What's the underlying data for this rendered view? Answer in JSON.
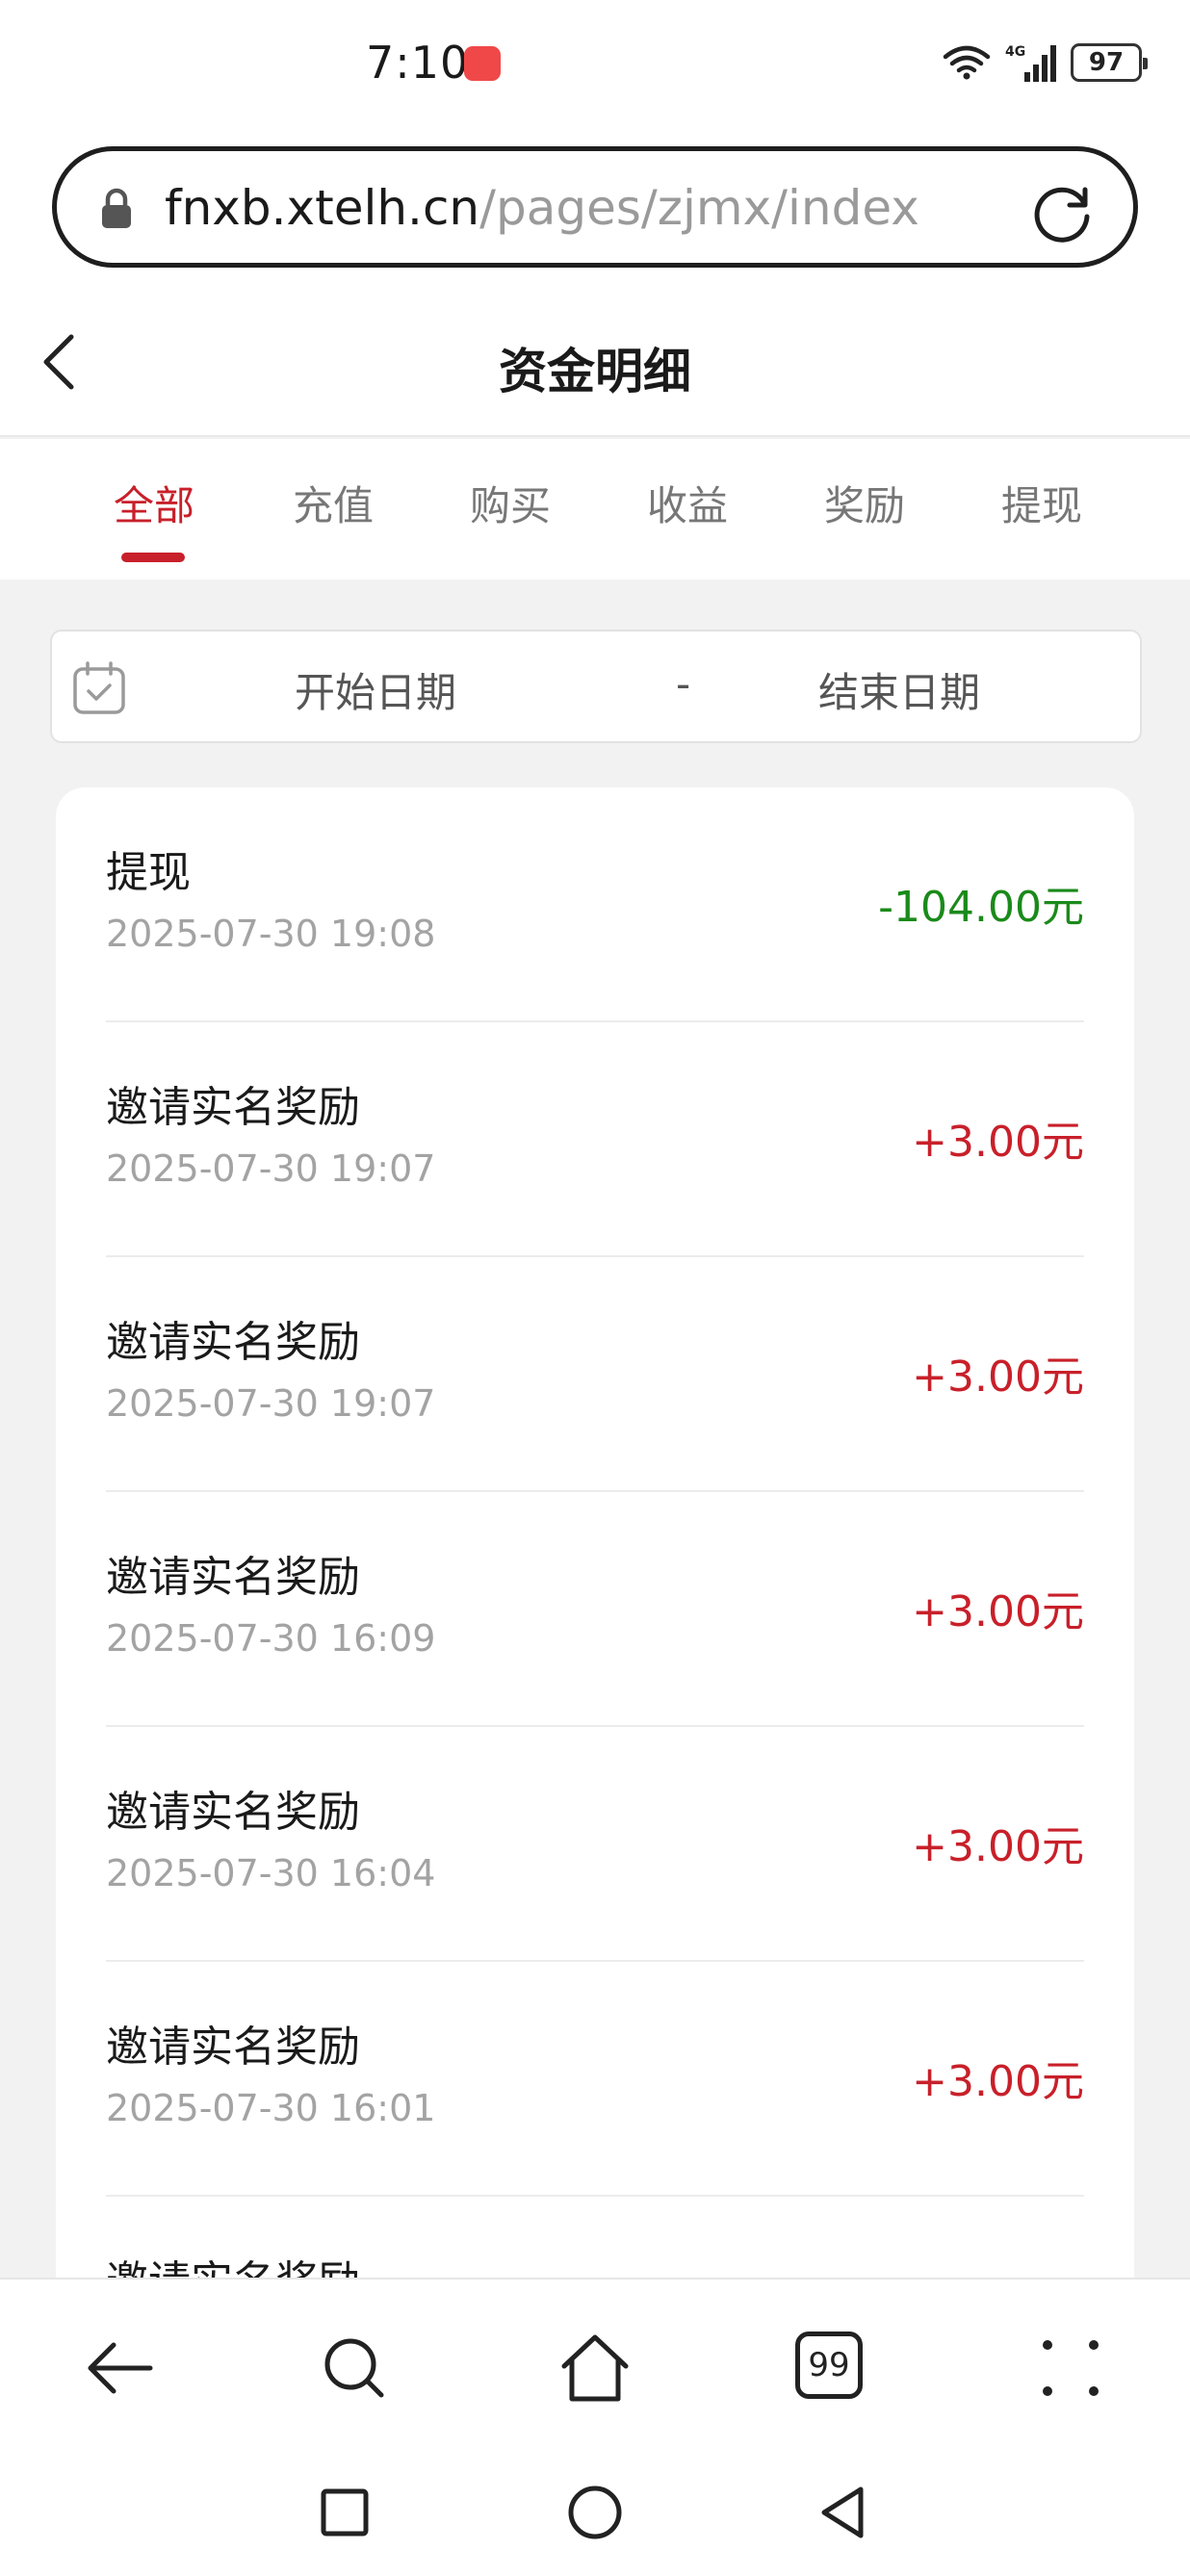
{
  "status_bar": {
    "time": "7:10",
    "network": "4G",
    "battery": "97"
  },
  "url_bar": {
    "host": "fnxb.xtelh.cn",
    "path": "/pages/zjmx/index"
  },
  "header": {
    "title": "资金明细"
  },
  "tabs": [
    {
      "label": "全部",
      "active": true
    },
    {
      "label": "充值",
      "active": false
    },
    {
      "label": "购买",
      "active": false
    },
    {
      "label": "收益",
      "active": false
    },
    {
      "label": "奖励",
      "active": false
    },
    {
      "label": "提现",
      "active": false
    }
  ],
  "date_filter": {
    "start_placeholder": "开始日期",
    "separator": "-",
    "end_placeholder": "结束日期"
  },
  "records": [
    {
      "title": "提现",
      "time": "2025-07-30 19:08",
      "amount": "-104.00元",
      "type": "expense"
    },
    {
      "title": "邀请实名奖励",
      "time": "2025-07-30 19:07",
      "amount": "+3.00元",
      "type": "income"
    },
    {
      "title": "邀请实名奖励",
      "time": "2025-07-30 19:07",
      "amount": "+3.00元",
      "type": "income"
    },
    {
      "title": "邀请实名奖励",
      "time": "2025-07-30 16:09",
      "amount": "+3.00元",
      "type": "income"
    },
    {
      "title": "邀请实名奖励",
      "time": "2025-07-30 16:04",
      "amount": "+3.00元",
      "type": "income"
    },
    {
      "title": "邀请实名奖励",
      "time": "2025-07-30 16:01",
      "amount": "+3.00元",
      "type": "income"
    },
    {
      "title": "邀请实名奖励",
      "time": "",
      "amount": "",
      "type": "income"
    }
  ],
  "browser_nav": {
    "tab_count": "99"
  },
  "colors": {
    "accent": "#c8202a",
    "expense": "#1a8a1a",
    "income": "#c8202a",
    "background": "#f2f2f2"
  }
}
